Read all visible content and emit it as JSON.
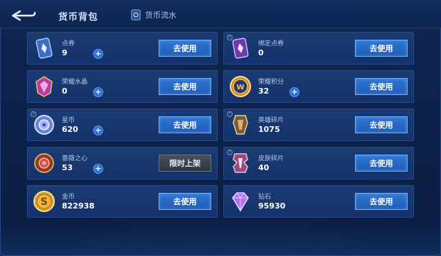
{
  "header": {
    "title": "货币背包",
    "flow_label": "货币流水"
  },
  "left": [
    {
      "label": "点券",
      "value": "9",
      "plus": true,
      "action": "去使用"
    },
    {
      "label": "荣耀水晶",
      "value": "0",
      "plus": true,
      "action": "去使用"
    },
    {
      "label": "星币",
      "value": "620",
      "plus": true,
      "action": "去使用"
    },
    {
      "label": "蔷薇之心",
      "value": "53",
      "plus": true,
      "action": "限时上架"
    },
    {
      "label": "金币",
      "value": "822938",
      "plus": false,
      "action": "去使用"
    }
  ],
  "right": [
    {
      "label": "绑定点券",
      "value": "0",
      "plus": false,
      "action": "去使用"
    },
    {
      "label": "荣耀积分",
      "value": "32",
      "plus": true,
      "action": "去使用"
    },
    {
      "label": "英雄碎片",
      "value": "1075",
      "plus": false,
      "action": "去使用"
    },
    {
      "label": "皮肤碎片",
      "value": "40",
      "plus": false,
      "action": "去使用"
    },
    {
      "label": "钻石",
      "value": "95930",
      "plus": false,
      "action": "去使用"
    }
  ],
  "icons": {
    "voucher": "voucher-card-icon",
    "crystal": "glory-crystal-icon",
    "star_coin": "star-coin-icon",
    "rose_heart": "rose-heart-icon",
    "gold_coin": "gold-coin-icon",
    "bound_voucher": "bound-voucher-icon",
    "glory_points": "glory-points-icon",
    "hero_shard": "hero-shard-icon",
    "skin_shard": "skin-shard-icon",
    "diamond": "diamond-icon"
  },
  "colors": {
    "button_blue": "#2f76d4",
    "button_border": "#6fb0ff",
    "limited_gray": "#3a414d",
    "card_bg": "#1a3b74"
  }
}
